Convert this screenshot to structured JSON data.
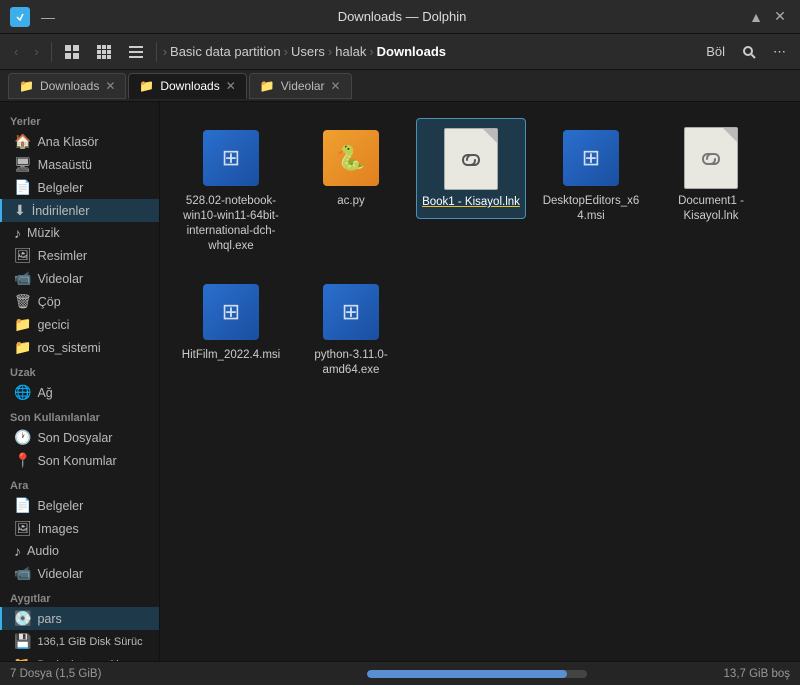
{
  "titlebar": {
    "title": "Downloads — Dolphin",
    "minimize": "—",
    "maximize": "▲",
    "close": "✕"
  },
  "toolbar": {
    "back": "‹",
    "forward": "›",
    "view_icons": "⊞",
    "view_grid": "⊟",
    "view_list": "≡",
    "split": "Böl",
    "search_icon": "🔍",
    "menu_icon": "⋯",
    "breadcrumb": [
      {
        "label": "Basic data partition",
        "sep": "›"
      },
      {
        "label": "Users",
        "sep": "›"
      },
      {
        "label": "halak",
        "sep": "›"
      },
      {
        "label": "Downloads",
        "sep": "",
        "active": true
      }
    ]
  },
  "tabs": [
    {
      "label": "Downloads",
      "active": false,
      "icon": "📁"
    },
    {
      "label": "Downloads",
      "active": true,
      "icon": "📁"
    },
    {
      "label": "Videolar",
      "active": false,
      "icon": "📁"
    }
  ],
  "sidebar": {
    "sections": [
      {
        "title": "Yerler",
        "items": [
          {
            "label": "Ana Klasör",
            "icon": "🏠"
          },
          {
            "label": "Masaüstü",
            "icon": "🖥"
          },
          {
            "label": "Belgeler",
            "icon": "📄"
          },
          {
            "label": "İndirilenler",
            "icon": "⬇",
            "highlighted": true
          },
          {
            "label": "Müzik",
            "icon": "♪"
          },
          {
            "label": "Resimler",
            "icon": "🖼"
          },
          {
            "label": "Videolar",
            "icon": "🗑"
          },
          {
            "label": "Çöp",
            "icon": "🗑"
          },
          {
            "label": "gecici",
            "icon": "📁"
          },
          {
            "label": "ros_sistemi",
            "icon": "📁"
          }
        ]
      },
      {
        "title": "Uzak",
        "items": [
          {
            "label": "Ağ",
            "icon": "🌐"
          }
        ]
      },
      {
        "title": "Son Kullanılanlar",
        "items": [
          {
            "label": "Son Dosyalar",
            "icon": "🕐"
          },
          {
            "label": "Son Konumlar",
            "icon": "📍"
          }
        ]
      },
      {
        "title": "Ara",
        "items": [
          {
            "label": "Belgeler",
            "icon": "📄"
          },
          {
            "label": "Images",
            "icon": "🖼"
          },
          {
            "label": "Audio",
            "icon": "♪"
          },
          {
            "label": "Videolar",
            "icon": "📹"
          }
        ]
      },
      {
        "title": "Aygıtlar",
        "items": [
          {
            "label": "pars",
            "icon": "💽",
            "highlighted": true
          },
          {
            "label": "136,1 GiB Disk Sürüc",
            "icon": "💾"
          },
          {
            "label": "Basic data partition",
            "icon": "📂"
          }
        ]
      }
    ]
  },
  "files": [
    {
      "name": "528.02-notebook-win10-win11-64bit-international-dch-whql.exe",
      "type": "msi",
      "selected": false
    },
    {
      "name": "ac.py",
      "type": "py",
      "selected": false
    },
    {
      "name": "Book1 - Kisayol.lnk",
      "type": "lnk",
      "selected": true
    },
    {
      "name": "DesktopEditors_x64.msi",
      "type": "msi",
      "selected": false
    },
    {
      "name": "Document1 - Kisayol.lnk",
      "type": "doc",
      "selected": false
    },
    {
      "name": "HitFilm_2022.4.msi",
      "type": "msi",
      "selected": false
    },
    {
      "name": "python-3.11.0-amd64.exe",
      "type": "msi",
      "selected": false
    }
  ],
  "statusbar": {
    "text": "7 Dosya (1,5 GiB)",
    "free": "13,7 GiB boş",
    "storage_percent": 91
  }
}
